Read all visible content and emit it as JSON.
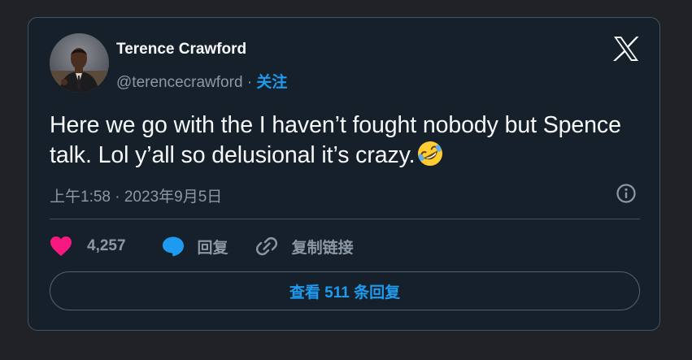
{
  "tweet": {
    "author": {
      "name": "Terence Crawford",
      "handle": "@terencecrawford",
      "separator": " · ",
      "follow_label": "关注"
    },
    "text": "Here we go with the I haven’t fought nobody but Spence talk. Lol y’all so delusional it’s crazy.",
    "emoji": "rolling-on-floor-laughing",
    "timestamp": "上午1:58 · 2023年9月5日"
  },
  "actions": {
    "like_count": "4,257",
    "reply_label": "回复",
    "copy_link_label": "复制链接"
  },
  "view_replies_label": "查看 511 条回复",
  "colors": {
    "page_background": "#202226",
    "card_background": "#15202b",
    "border": "#425364",
    "primary_text": "#f7f9f9",
    "secondary_text": "#8b98a5",
    "accent_blue": "#1d9bf0",
    "like_pink": "#f91880"
  },
  "icons": [
    "x-logo-icon",
    "info-icon",
    "heart-icon",
    "reply-bubble-icon",
    "link-icon",
    "rofl-emoji-icon"
  ]
}
